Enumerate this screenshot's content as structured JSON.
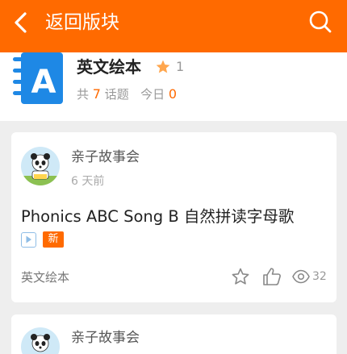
{
  "header": {
    "back_label": "返回版块",
    "icons": {
      "back": "chevron-left-icon",
      "search": "search-icon"
    },
    "background": "#ff6a00"
  },
  "board": {
    "name": "英文绘本",
    "star_count": "1",
    "stats_prefix": "共",
    "topic_count": "7",
    "topic_label": "话题",
    "today_label": "今日",
    "today_count": "0",
    "icon_letter": "A"
  },
  "posts": [
    {
      "author": "亲子故事会",
      "time": "6 天前",
      "title": "Phonics ABC Song B 自然拼读字母歌",
      "badge_new": "新",
      "board": "英文绘本",
      "views": "32"
    },
    {
      "author": "亲子故事会"
    }
  ],
  "colors": {
    "accent": "#ff6a00",
    "star": "#ffa64d",
    "board_icon": "#1e88e5"
  }
}
